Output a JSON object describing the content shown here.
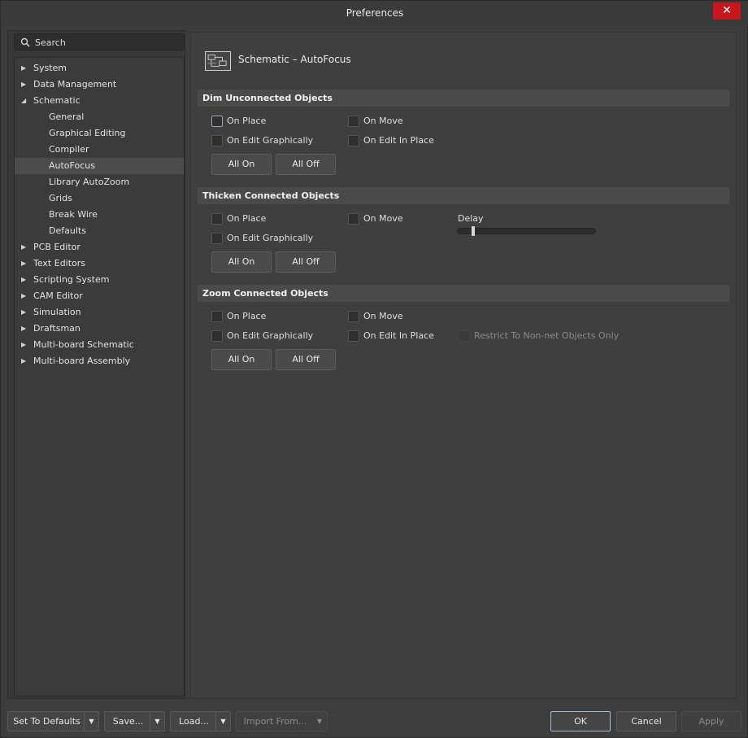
{
  "window": {
    "title": "Preferences",
    "close_glyph": "✕"
  },
  "search": {
    "label": "Search",
    "icon": "search-icon"
  },
  "tree": [
    {
      "label": "System",
      "level": 0,
      "arrow": "▶"
    },
    {
      "label": "Data Management",
      "level": 0,
      "arrow": "▶"
    },
    {
      "label": "Schematic",
      "level": 0,
      "arrow": "◢"
    },
    {
      "label": "General",
      "level": 1
    },
    {
      "label": "Graphical Editing",
      "level": 1
    },
    {
      "label": "Compiler",
      "level": 1
    },
    {
      "label": "AutoFocus",
      "level": 1,
      "selected": true
    },
    {
      "label": "Library AutoZoom",
      "level": 1
    },
    {
      "label": "Grids",
      "level": 1
    },
    {
      "label": "Break Wire",
      "level": 1
    },
    {
      "label": "Defaults",
      "level": 1
    },
    {
      "label": "PCB Editor",
      "level": 0,
      "arrow": "▶"
    },
    {
      "label": "Text Editors",
      "level": 0,
      "arrow": "▶"
    },
    {
      "label": "Scripting System",
      "level": 0,
      "arrow": "▶"
    },
    {
      "label": "CAM Editor",
      "level": 0,
      "arrow": "▶"
    },
    {
      "label": "Simulation",
      "level": 0,
      "arrow": "▶"
    },
    {
      "label": "Draftsman",
      "level": 0,
      "arrow": "▶"
    },
    {
      "label": "Multi-board Schematic",
      "level": 0,
      "arrow": "▶"
    },
    {
      "label": "Multi-board Assembly",
      "level": 0,
      "arrow": "▶"
    }
  ],
  "page": {
    "title": "Schematic – AutoFocus",
    "icon": "schematic-page-icon"
  },
  "sections": {
    "dim": {
      "header": "Dim Unconnected Objects",
      "on_place": "On Place",
      "on_move": "On Move",
      "on_edit_graphically": "On Edit Graphically",
      "on_edit_in_place": "On Edit In Place",
      "all_on": "All On",
      "all_off": "All Off"
    },
    "thicken": {
      "header": "Thicken Connected Objects",
      "on_place": "On Place",
      "on_move": "On Move",
      "on_edit_graphically": "On Edit Graphically",
      "delay_label": "Delay",
      "all_on": "All On",
      "all_off": "All Off"
    },
    "zoom": {
      "header": "Zoom Connected Objects",
      "on_place": "On Place",
      "on_move": "On Move",
      "on_edit_graphically": "On Edit Graphically",
      "on_edit_in_place": "On Edit In Place",
      "restrict": "Restrict To Non-net Objects Only",
      "all_on": "All On",
      "all_off": "All Off"
    }
  },
  "footer": {
    "set_to_defaults": "Set To Defaults",
    "save": "Save...",
    "load": "Load...",
    "import_from": "Import From...",
    "ok": "OK",
    "cancel": "Cancel",
    "apply": "Apply",
    "dropdown_glyph": "▼"
  }
}
